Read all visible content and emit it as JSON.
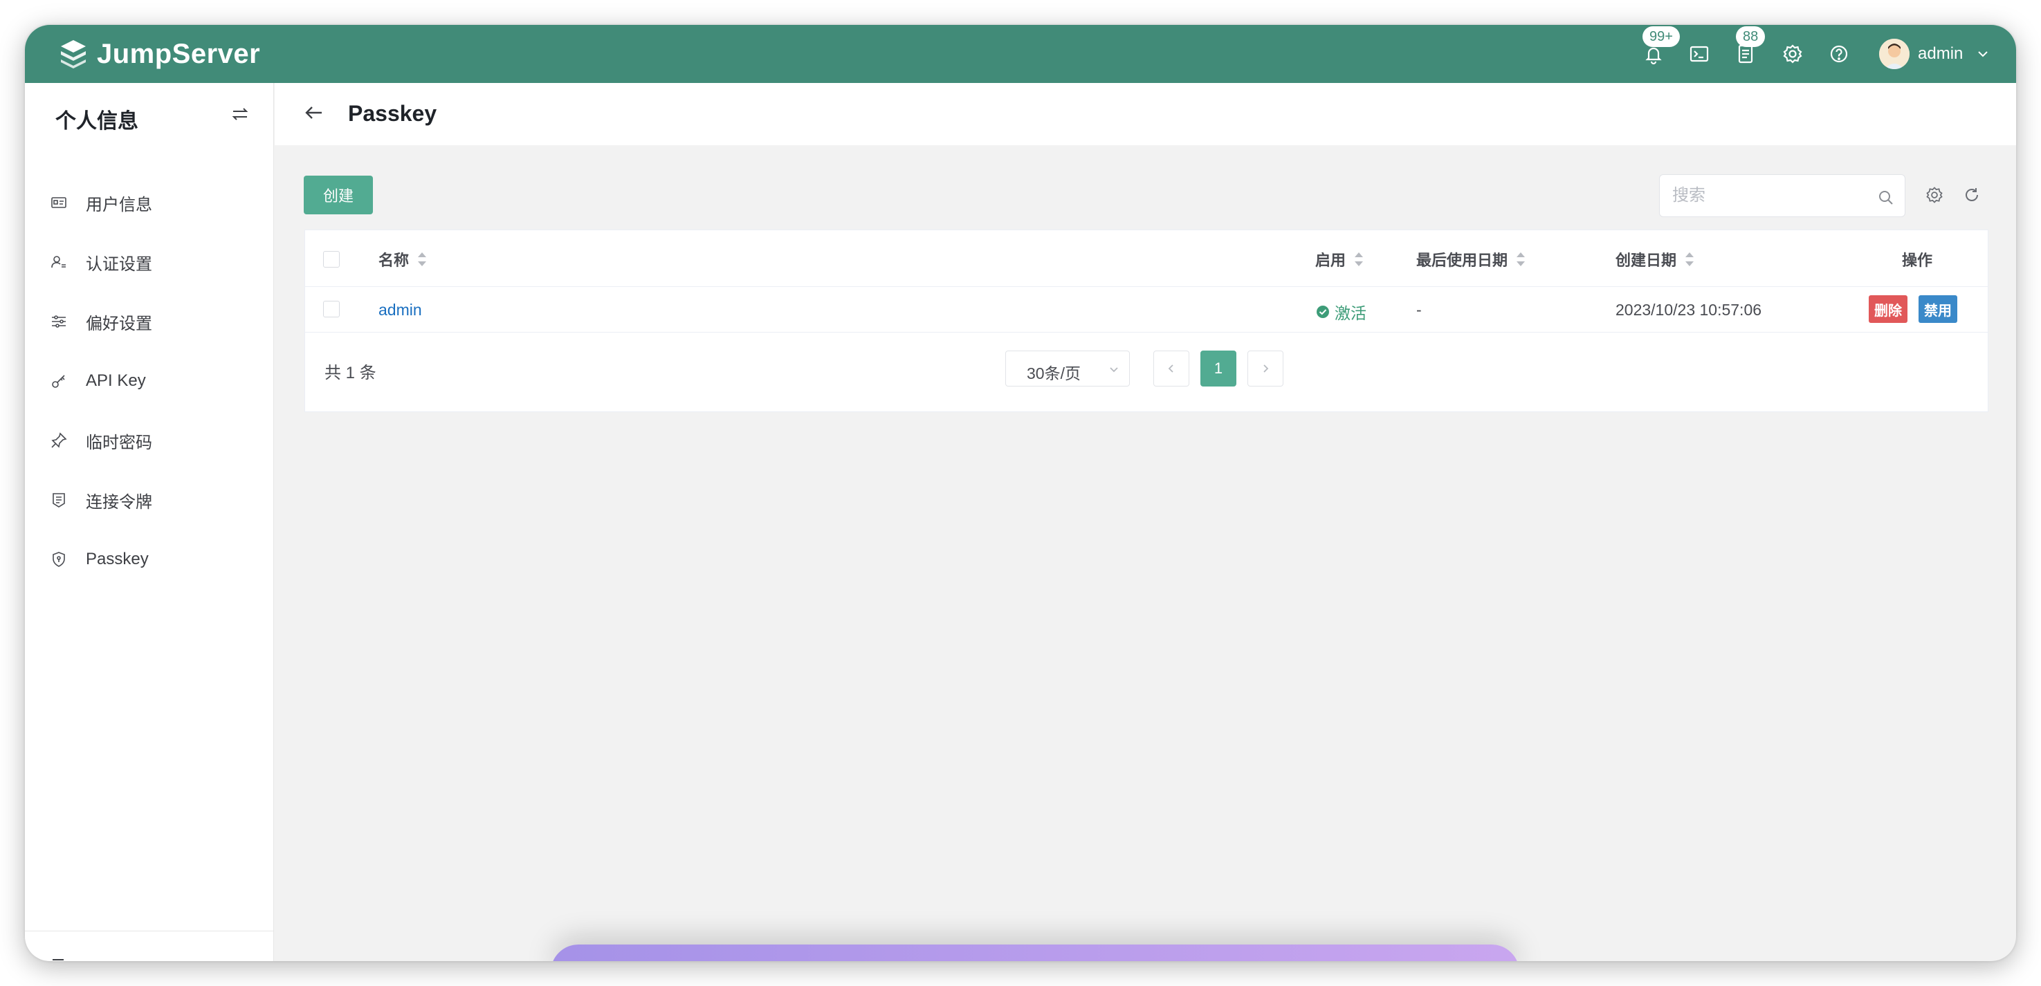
{
  "brand": {
    "name": "JumpServer"
  },
  "header": {
    "notification_badge": "99+",
    "tickets_badge": "88",
    "username": "admin"
  },
  "sidebar": {
    "title": "个人信息",
    "items": [
      {
        "label": "用户信息",
        "icon": "id-card-icon"
      },
      {
        "label": "认证设置",
        "icon": "user-lock-icon"
      },
      {
        "label": "偏好设置",
        "icon": "sliders-icon"
      },
      {
        "label": "API Key",
        "icon": "key-icon"
      },
      {
        "label": "临时密码",
        "icon": "pin-icon"
      },
      {
        "label": "连接令牌",
        "icon": "token-icon"
      },
      {
        "label": "Passkey",
        "icon": "shield-icon"
      }
    ]
  },
  "page": {
    "title": "Passkey"
  },
  "toolbar": {
    "create_label": "创建",
    "search_placeholder": "搜索"
  },
  "table": {
    "columns": {
      "name": "名称",
      "enabled": "启用",
      "last_used": "最后使用日期",
      "created": "创建日期",
      "actions": "操作"
    },
    "rows": [
      {
        "name": "admin",
        "enabled": "激活",
        "last_used": "-",
        "created": "2023/10/23 10:57:06",
        "delete_label": "删除",
        "disable_label": "禁用"
      }
    ]
  },
  "pagination": {
    "total": "共 1 条",
    "page_size": "30条/页",
    "current_page": "1"
  },
  "colors": {
    "header": "#418b78",
    "primary": "#52ab92",
    "danger": "#e15859",
    "info": "#3a89c9",
    "link": "#1a6fc0"
  }
}
